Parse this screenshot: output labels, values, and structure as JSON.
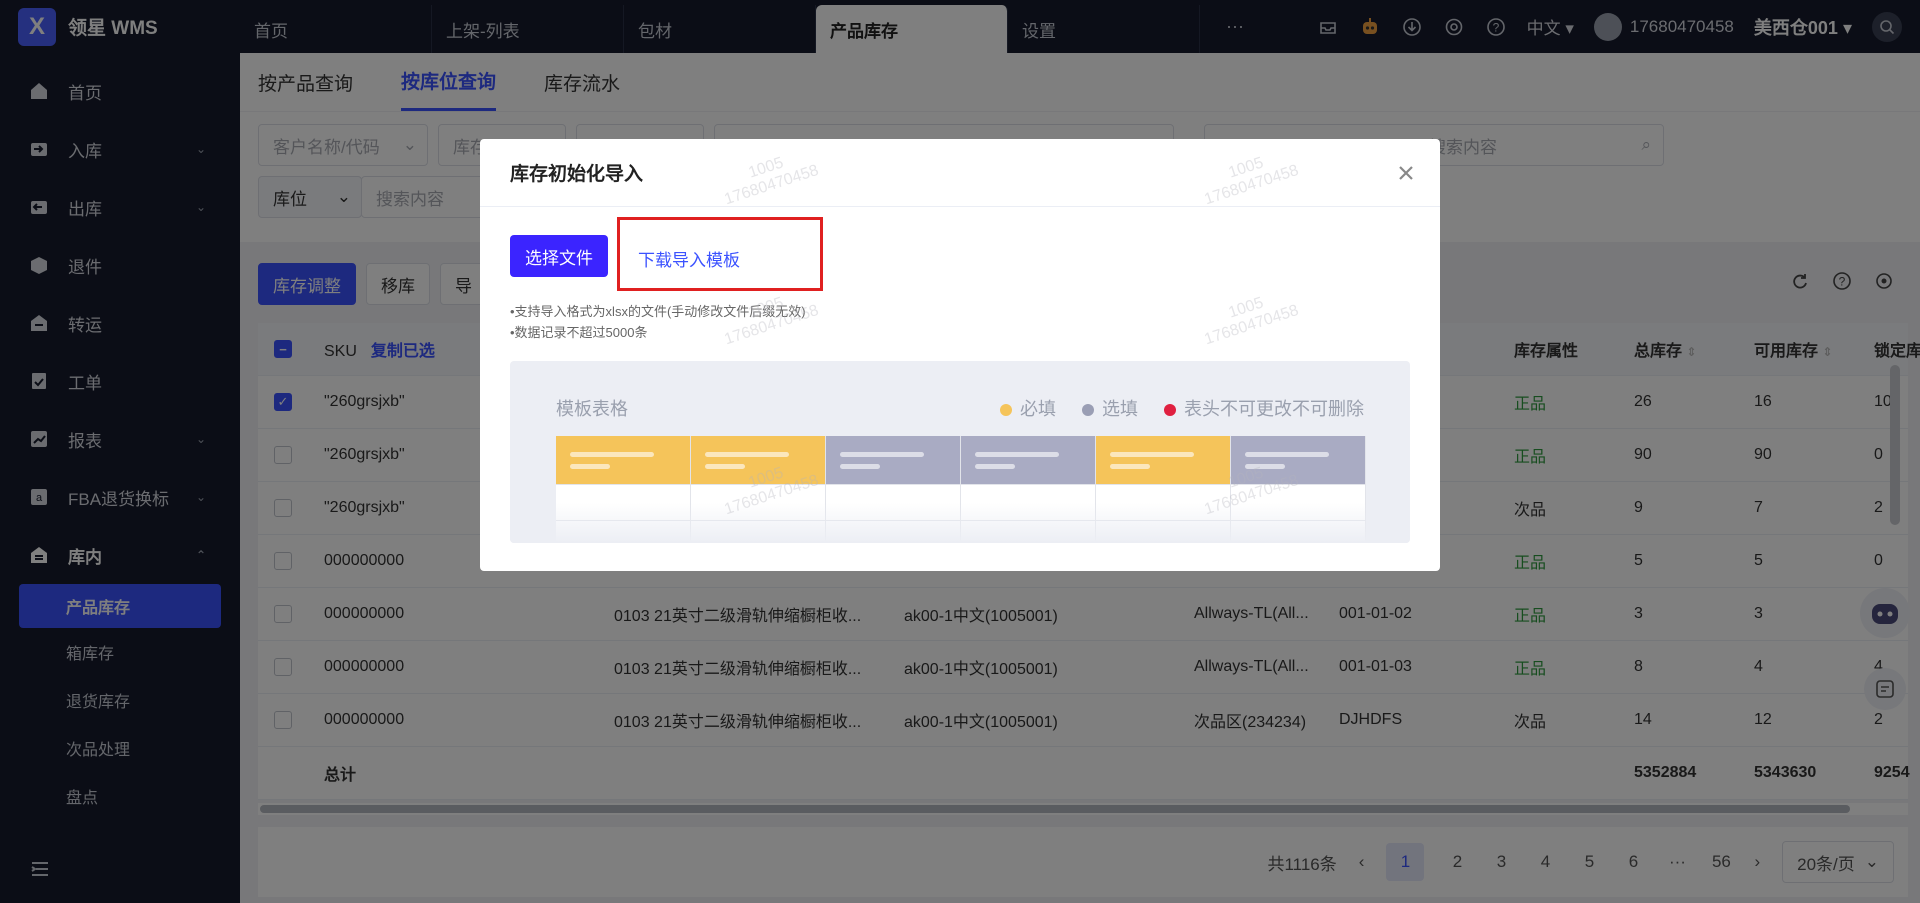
{
  "app": {
    "logo_letter": "X",
    "name": "领星 WMS"
  },
  "top_tabs": [
    "首页",
    "上架-列表",
    "包材",
    "产品库存",
    "设置"
  ],
  "top_more": "···",
  "top_right": {
    "language": "中文",
    "user": "17680470458",
    "warehouse": "美西仓001"
  },
  "sidebar": {
    "items": [
      {
        "label": "首页",
        "icon": "home-icon"
      },
      {
        "label": "入库",
        "icon": "inbound-icon",
        "arrow": "⌄"
      },
      {
        "label": "出库",
        "icon": "outbound-icon",
        "arrow": "⌄"
      },
      {
        "label": "退件",
        "icon": "return-icon"
      },
      {
        "label": "转运",
        "icon": "transfer-icon"
      },
      {
        "label": "工单",
        "icon": "workorder-icon"
      },
      {
        "label": "报表",
        "icon": "report-icon",
        "arrow": "⌄"
      },
      {
        "label": "FBA退货换标",
        "icon": "fba-icon",
        "arrow": "⌄"
      },
      {
        "label": "库内",
        "icon": "warehouse-icon",
        "arrow": "⌃"
      }
    ],
    "sub_items": [
      "产品库存",
      "箱库存",
      "退货库存",
      "次品处理",
      "盘点"
    ]
  },
  "subtabs": [
    "按产品查询",
    "按库位查询",
    "库存流水"
  ],
  "filters": {
    "customer_placeholder": "客户名称/代码",
    "box2": "库存",
    "search_placeholder": "搜索内容",
    "location_label": "库位",
    "search2_placeholder": "搜索内容"
  },
  "toolbar": {
    "adjust": "库存调整",
    "move": "移库",
    "export_prefix": "导"
  },
  "table": {
    "headers": {
      "sku": "SKU",
      "copy": "复制已选",
      "attr": "库存属性",
      "total": "总库存",
      "avail": "可用库存",
      "locked": "锁定库存"
    },
    "rows": [
      {
        "sku": "\"260grsjxb\"",
        "name": "",
        "code": "",
        "zone": "",
        "loc": "",
        "attr": "正品",
        "total": "26",
        "avail": "16",
        "locked": "10",
        "checked": true
      },
      {
        "sku": "\"260grsjxb\"",
        "name": "",
        "code": "",
        "zone": "",
        "loc": "",
        "attr": "正品",
        "total": "90",
        "avail": "90",
        "locked": "0",
        "checked": false
      },
      {
        "sku": "\"260grsjxb\"",
        "name": "",
        "code": "",
        "zone": "",
        "loc": "",
        "attr": "次品",
        "total": "9",
        "avail": "7",
        "locked": "2",
        "checked": false
      },
      {
        "sku": "000000000",
        "name": "",
        "code": "",
        "zone": "",
        "loc": "",
        "attr": "正品",
        "total": "5",
        "avail": "5",
        "locked": "0",
        "checked": false
      },
      {
        "sku": "000000000",
        "name": "0103 21英寸二级滑轨伸缩橱柜收...",
        "code": "ak00-1中文(1005001)",
        "zone": "Allways-TL(All...",
        "loc": "001-01-02",
        "attr": "正品",
        "total": "3",
        "avail": "3",
        "locked": "0",
        "checked": false
      },
      {
        "sku": "000000000",
        "name": "0103 21英寸二级滑轨伸缩橱柜收...",
        "code": "ak00-1中文(1005001)",
        "zone": "Allways-TL(All...",
        "loc": "001-01-03",
        "attr": "正品",
        "total": "8",
        "avail": "4",
        "locked": "4",
        "checked": false
      },
      {
        "sku": "000000000",
        "name": "0103 21英寸二级滑轨伸缩橱柜收...",
        "code": "ak00-1中文(1005001)",
        "zone": "次品区(234234)",
        "loc": "DJHDFS",
        "attr": "次品",
        "total": "14",
        "avail": "12",
        "locked": "2",
        "checked": false
      }
    ],
    "total_row": {
      "label": "总计",
      "total": "5352884",
      "avail": "5343630",
      "locked": "9254"
    }
  },
  "pager": {
    "count": "共1116条",
    "pages": [
      "1",
      "2",
      "3",
      "4",
      "5",
      "6",
      "···",
      "56"
    ],
    "size": "20条/页"
  },
  "modal": {
    "title": "库存初始化导入",
    "pick_button": "选择文件",
    "download_link": "下载导入模板",
    "hint1": "•支持导入格式为xlsx的文件(手动修改文件后缀无效)",
    "hint2": "•数据记录不超过5000条",
    "template_title": "模板表格",
    "legend": [
      {
        "label": "必填",
        "color": "#f5c45a"
      },
      {
        "label": "选填",
        "color": "#9a9eb4"
      },
      {
        "label": "表头不可更改不可删除",
        "color": "#e02040"
      }
    ]
  },
  "watermark": [
    "17680470458",
    "1005"
  ],
  "colors": {
    "primary": "#3b52ff",
    "required": "#f5c45a",
    "optional": "#a9abc3",
    "highlight": "#e02020"
  }
}
